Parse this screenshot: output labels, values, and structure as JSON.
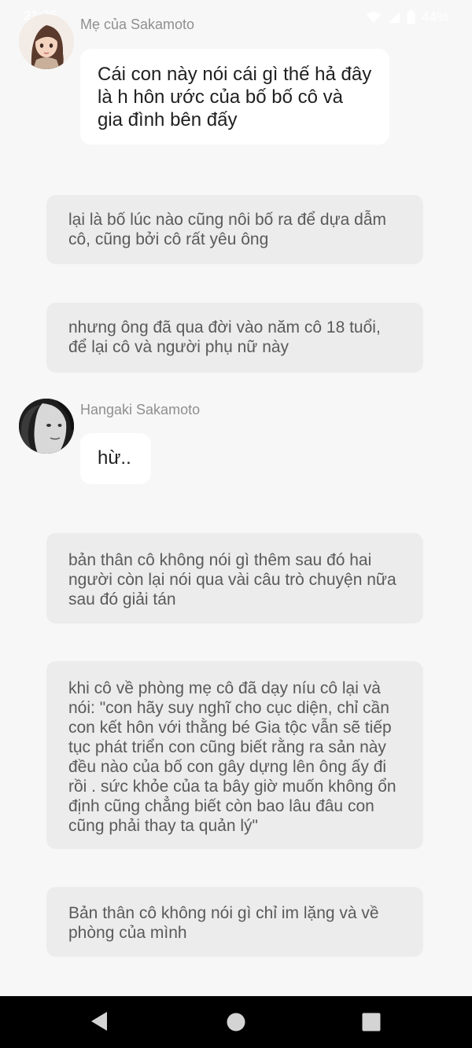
{
  "status_bar": {
    "time": "21:36",
    "battery_percent": "44%",
    "icons": [
      "wifi-icon",
      "signal-icon",
      "battery-icon"
    ]
  },
  "messages": [
    {
      "sender": "Mẹ của Sakamoto",
      "text": "Cái con này nói cái gì thế hả đây là h hôn ước của bố bố cô và gia đình bên đấy"
    },
    {
      "sender": "Hangaki Sakamoto",
      "text": "hừ.."
    }
  ],
  "narrations": [
    "lại là bố lúc nào cũng nôi bố ra để dựa dẫm cô, cũng bởi cô rất yêu ông",
    "nhưng ông đã qua đời vào năm cô 18 tuổi, để lại cô và người phụ nữ này",
    "bản thân cô không nói gì thêm sau đó hai người còn lại nói qua vài câu trò chuyện nữa sau đó giải tán",
    "khi cô về phòng mẹ cô đã dạy níu cô lại và nói: \"con hãy suy nghĩ cho cục diện, chỉ cần con kết hôn với  thằng bé Gia tộc vẫn sẽ tiếp tục phát triển con cũng biết rằng ra sản này đều nào của bố con gây dựng lên ông ấy đi rồi . sức khỏe của ta bây giờ muốn không ổn định cũng chẳng biết còn bao lâu đâu con cũng phải thay ta quản lý\"",
    "Bản thân cô không nói gì chỉ im lặng và về phòng của mình"
  ],
  "nav_bar": {
    "buttons": [
      "back-icon",
      "home-icon",
      "recents-icon"
    ]
  },
  "colors": {
    "background": "#f7f7f7",
    "bubble": "#ffffff",
    "narration": "#ececec",
    "nav_bar": "#000000"
  }
}
